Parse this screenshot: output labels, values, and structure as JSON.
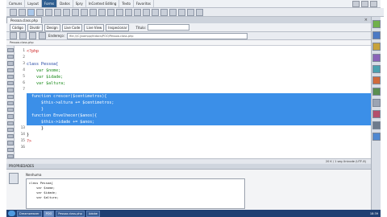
{
  "window": {
    "tab_title": "Pessoa.class.php",
    "close_glyph": "×"
  },
  "menu": {
    "items": [
      "Comuns",
      "Layout",
      "Forms",
      "Dados",
      "Spry",
      "InContext Editing",
      "Texto",
      "Favoritos"
    ],
    "active_index": 2
  },
  "view_buttons": [
    "Código",
    "Dividir",
    "Design",
    "Live Code",
    "Live View",
    "Inspecionar"
  ],
  "view_title_label": "Título:",
  "address": {
    "label": "Endereço:",
    "value": "file:///C|/xampp/htdocs/POO/Pessoa.class.php"
  },
  "path_strip": "Pessoa.class.php",
  "code_lines": [
    {
      "n": "1",
      "text": "<?php",
      "sel": false
    },
    {
      "n": "2",
      "text": "",
      "sel": false
    },
    {
      "n": "3",
      "text": "class Pessoa{",
      "sel": false
    },
    {
      "n": "4",
      "text": "    var $nome;",
      "sel": false
    },
    {
      "n": "5",
      "text": "    var $idade;",
      "sel": false
    },
    {
      "n": "6",
      "text": "    var $altura;",
      "sel": false
    },
    {
      "n": "7",
      "text": "",
      "sel": false
    },
    {
      "n": "8",
      "text": "  function crescer($centimetros){",
      "sel": true
    },
    {
      "n": "9",
      "text": "      $this->altura += $centimetros;",
      "sel": true
    },
    {
      "n": "10",
      "text": "      }",
      "sel": true
    },
    {
      "n": "11",
      "text": "  function Envelhecer($anos){",
      "sel": true
    },
    {
      "n": "12",
      "text": "      $this->idade += $anos;",
      "sel": true
    },
    {
      "n": "13",
      "text": "      }",
      "sel": false
    },
    {
      "n": "14",
      "text": "}",
      "sel": false
    },
    {
      "n": "15",
      "text": "?>",
      "sel": false
    },
    {
      "n": "16",
      "text": "",
      "sel": false
    }
  ],
  "status_text": "20 K / 1 seg  Unicode (UTF-8)",
  "properties": {
    "header": "PROPRIEDADES",
    "label": "Nenhuma",
    "lines": [
      "class Pessoa{",
      "    var $nome;",
      "    var $idade;",
      "    var $altura;"
    ]
  },
  "taskbar": {
    "tasks": [
      "Dreamweaver",
      "POO",
      "Pessoa.class.php",
      "Adobe"
    ],
    "active_index": 1,
    "clock": "18:39"
  }
}
